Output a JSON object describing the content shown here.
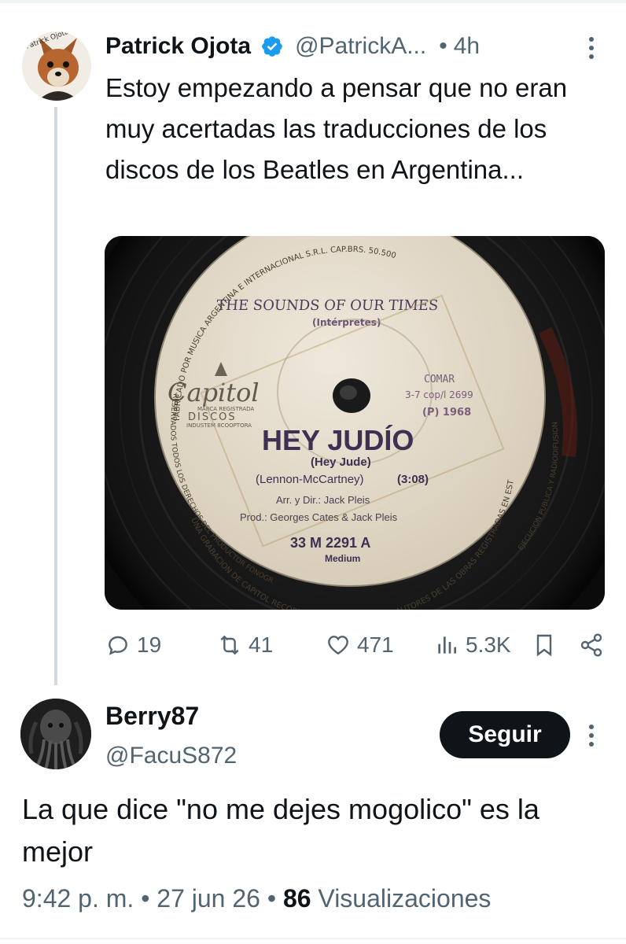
{
  "tweet": {
    "author_name": "Patrick Ojota",
    "author_handle": "@PatrickA...",
    "separator": "•",
    "time": "4h",
    "text": "Estoy empezando a pensar que no eran muy acertadas las traducciones de los discos de los Beatles en Argentina...",
    "avatar_text": "Patrick Ojota",
    "media": {
      "rim_text_top": "FABRICADO POR MUSICA ARGENTINA E INTERNACIONAL S.R.L. CAP.BRS. 50.500",
      "rim_text_bottom": "UNA GRABACION DE CAPITOL RECORDS, INC. U.S.A · Y DE LOS AUTORES DE LAS OBRAS REGISTRADAS EN ESTE DISCO PROHIBIDA SU",
      "rim_text_left": "RESERVADOS TODOS LOS DERECHOS DEL PRODUCTOR FONOGRAFICO",
      "rim_text_right": "EJECUCION PUBLICA Y RADIODIFUSION",
      "artist": "THE SOUNDS OF OUR TIMES",
      "artist_role": "(Intérpretes)",
      "label_logo": "Capitol",
      "label_sub1": "MARCA REGISTRADA",
      "label_sub2": "DISCOS",
      "label_sub3": "INDUSTEM 8COOPTORA",
      "comar_line1": "COMAR",
      "comar_line2": "3-7 cop/l 2699",
      "comar_line3": "(P) 1968",
      "song_title": "HEY JUDÍO",
      "song_subtitle": "(Hey Jude)",
      "songwriters": "(Lennon-McCartney)",
      "duration": "(3:08)",
      "arranger": "Arr. y Dir.: Jack Pleis",
      "producer": "Prod.: Georges Cates & Jack Pleis",
      "catalog": "33 M 2291 A",
      "speed": "Medium"
    },
    "actions": {
      "replies": "19",
      "retweets": "41",
      "likes": "471",
      "views": "5.3K"
    }
  },
  "reply": {
    "author_name": "Berry87",
    "author_handle": "@FacuS872",
    "follow_label": "Seguir",
    "text": "La que dice \"no me dejes mogolico\"  es la mejor",
    "time": "9:42 p. m.",
    "sep1": "•",
    "date": "27 jun 26",
    "sep2": "•",
    "views_count": "86",
    "views_label": "Visualizaciones"
  },
  "colors": {
    "text_primary": "#0f1419",
    "text_secondary": "#536471",
    "verified_blue": "#1d9bf0",
    "thread_line": "#cfd9de"
  }
}
